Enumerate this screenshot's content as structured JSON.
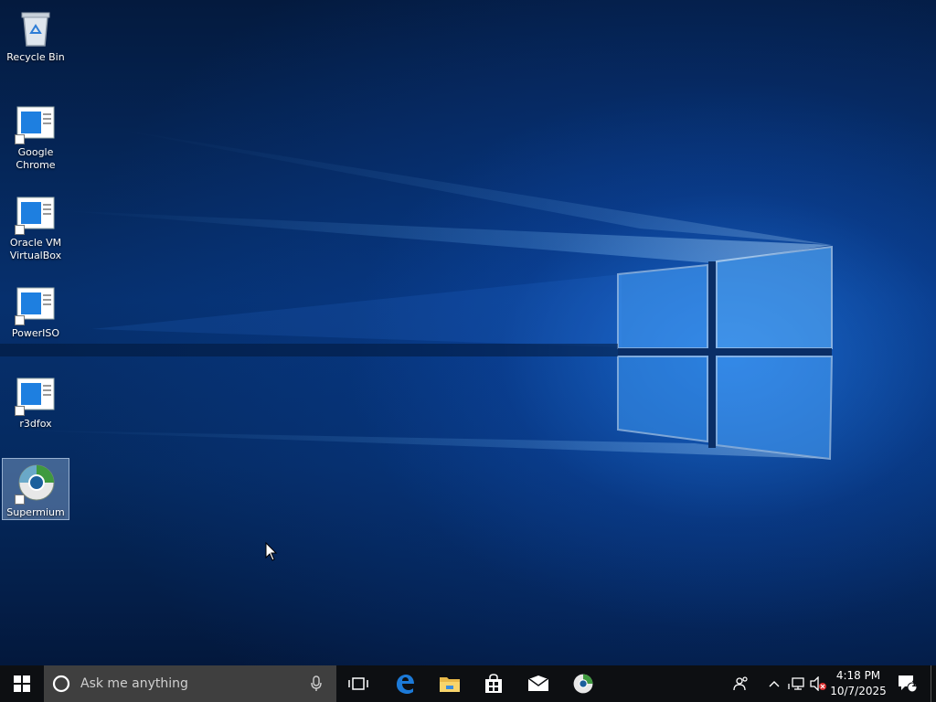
{
  "desktop": {
    "icons": [
      {
        "label": "Recycle Bin",
        "type": "recycle-bin"
      },
      {
        "label": "Google Chrome",
        "type": "shortcut"
      },
      {
        "label": "Oracle VM VirtualBox",
        "type": "shortcut"
      },
      {
        "label": "PowerISO",
        "type": "shortcut"
      },
      {
        "label": "r3dfox",
        "type": "shortcut"
      },
      {
        "label": "Supermium",
        "type": "shortcut",
        "selected": true
      }
    ]
  },
  "taskbar": {
    "search_placeholder": "Ask me anything",
    "pinned": [
      "task-view-icon",
      "edge-icon",
      "file-explorer-icon",
      "store-icon",
      "mail-icon",
      "supermium-icon"
    ],
    "tray": {
      "icons": [
        "people-icon",
        "chevron-up-icon",
        "network-icon",
        "volume-muted-icon"
      ],
      "time": "4:18 PM",
      "date": "10/7/2025",
      "notification_count": "1"
    }
  },
  "colors": {
    "taskbar": "#0d0f12",
    "search_box": "#3f3f3f",
    "accent_blue": "#1e90ff"
  }
}
